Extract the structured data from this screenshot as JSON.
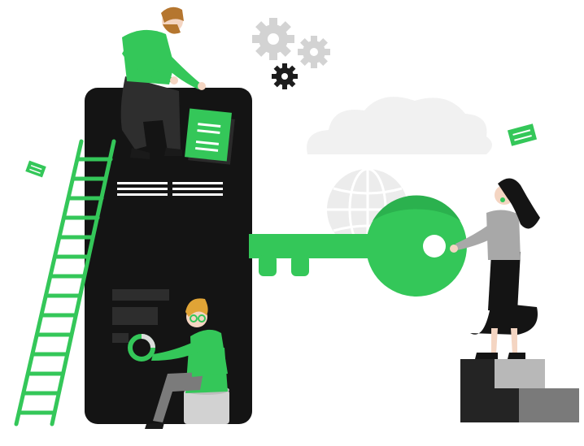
{
  "palette": {
    "accent_green": "#34c759",
    "dark_green": "#1f9e45",
    "phone_black": "#141414",
    "gear_gray": "#cfcfcf",
    "gear_dark": "#1c1c1c",
    "cloud_gray": "#f0f0f0",
    "globe_gray": "#e8e8e8",
    "step_dark": "#2a2a2a",
    "step_mid": "#7a7a7a",
    "step_light": "#b8b8b8",
    "skin": "#f4d5c2",
    "hair_orange": "#e08a3c"
  },
  "icons": {
    "key": "key-icon",
    "gears": "gear-icon",
    "cloud": "cloud-icon",
    "globe": "globe-icon",
    "document": "document-icon",
    "ladder": "ladder-icon"
  }
}
